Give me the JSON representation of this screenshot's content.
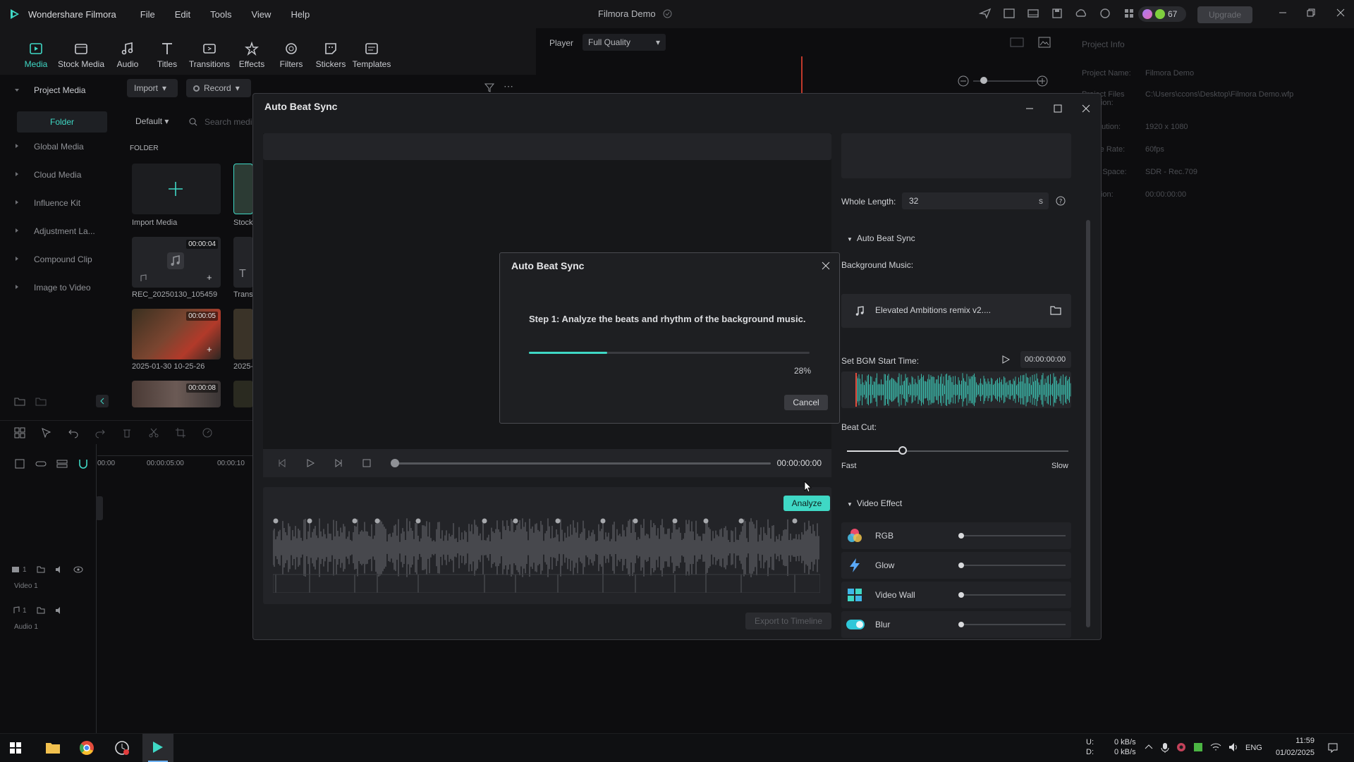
{
  "app": {
    "name": "Wondershare Filmora",
    "menu": [
      "File",
      "Edit",
      "Tools",
      "View",
      "Help"
    ],
    "project_title": "Filmora Demo",
    "credits": "67",
    "upgrade_label": "Upgrade"
  },
  "toolbar": {
    "tools": [
      {
        "label": "Media",
        "icon": "media-icon",
        "active": true
      },
      {
        "label": "Stock Media",
        "icon": "stock-media-icon"
      },
      {
        "label": "Audio",
        "icon": "audio-icon"
      },
      {
        "label": "Titles",
        "icon": "titles-icon"
      },
      {
        "label": "Transitions",
        "icon": "transitions-icon"
      },
      {
        "label": "Effects",
        "icon": "effects-icon"
      },
      {
        "label": "Filters",
        "icon": "filters-icon"
      },
      {
        "label": "Stickers",
        "icon": "stickers-icon"
      },
      {
        "label": "Templates",
        "icon": "templates-icon"
      }
    ]
  },
  "left_panel": {
    "project_media": "Project Media",
    "folder": "Folder",
    "items": [
      "Global Media",
      "Cloud Media",
      "Influence Kit",
      "Adjustment La...",
      "Compound Clip",
      "Image to Video"
    ]
  },
  "media": {
    "import_label": "Import",
    "record_label": "Record",
    "sort_label": "Default",
    "search_placeholder": "Search medi",
    "folder_header": "FOLDER",
    "import_media": "Import Media",
    "stock_label": "Stock",
    "clips": [
      {
        "name": "REC_20250130_105459",
        "duration": "00:00:04"
      },
      {
        "name": "Trans"
      },
      {
        "name": "2025-01-30 10-25-26",
        "duration": "00:00:05"
      },
      {
        "name": "2025-"
      },
      {
        "duration": "00:00:08"
      }
    ]
  },
  "player": {
    "label": "Player",
    "quality": "Full Quality"
  },
  "project_info": {
    "header": "Project Info",
    "rows": [
      {
        "label": "Project Name:",
        "value": "Filmora Demo"
      },
      {
        "label": "Project Files Location:",
        "value": "C:\\Users\\ccons\\Desktop\\Filmora Demo.wfp"
      },
      {
        "label": "Resolution:",
        "value": "1920 x 1080"
      },
      {
        "label": "Frame Rate:",
        "value": "60fps"
      },
      {
        "label": "Color Space:",
        "value": "SDR - Rec.709"
      },
      {
        "label": "Duration:",
        "value": "00:00:00:00"
      }
    ]
  },
  "timeline": {
    "ticks": [
      "00:00",
      "00:00:05:00",
      "00:00:10"
    ],
    "video_track": "Video 1",
    "audio_track": "Audio 1",
    "video_num": "1",
    "audio_num": "1"
  },
  "dialog": {
    "title": "Auto Beat Sync",
    "time": "00:00:00:00",
    "analyze_label": "Analyze",
    "export_label": "Export to Timeline",
    "whole_length_label": "Whole Length:",
    "whole_length_value": "32",
    "whole_length_unit": "s",
    "section_beat": "Auto Beat Sync",
    "bg_music_label": "Background Music:",
    "bg_music_name": "Elevated Ambitions remix v2....",
    "bgm_start_label": "Set BGM Start Time:",
    "bgm_start_value": "00:00:00:00",
    "beat_cut_label": "Beat Cut:",
    "beat_cut_fast": "Fast",
    "beat_cut_slow": "Slow",
    "beat_cut_level": 0.25,
    "section_video": "Video Effect",
    "effects": [
      {
        "name": "RGB",
        "icon": "rgb-icon",
        "level": 0
      },
      {
        "name": "Glow",
        "icon": "glow-icon",
        "level": 0
      },
      {
        "name": "Video Wall",
        "icon": "video-wall-icon",
        "level": 0
      },
      {
        "name": "Blur",
        "icon": "blur-icon",
        "level": 0
      }
    ]
  },
  "modal": {
    "title": "Auto Beat Sync",
    "step_text": "Step 1: Analyze the beats and rhythm of the background music.",
    "progress": 0.28,
    "progress_label": "28%",
    "cancel_label": "Cancel"
  },
  "taskbar": {
    "net_up_label": "U:",
    "net_down_label": "D:",
    "net_up": "0 kB/s",
    "net_down": "0 kB/s",
    "lang": "ENG",
    "time": "11:59",
    "date": "01/02/2025"
  },
  "colors": {
    "accent": "#3fd8c5",
    "background": "#0d0d0f",
    "dialog_bg": "#1b1c1f"
  }
}
